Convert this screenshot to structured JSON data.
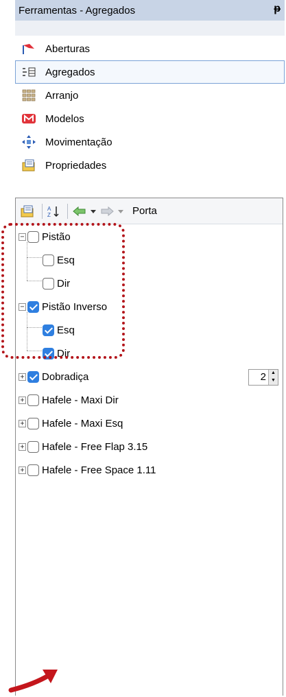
{
  "window": {
    "title": "Ferramentas - Agregados",
    "pin_glyph": "ᵽ"
  },
  "nav": {
    "items": [
      {
        "label": "Aberturas",
        "icon": "flag-icon"
      },
      {
        "label": "Agregados",
        "icon": "aggregates-icon",
        "selected": true
      },
      {
        "label": "Arranjo",
        "icon": "grid-icon"
      },
      {
        "label": "Modelos",
        "icon": "models-icon"
      },
      {
        "label": "Movimentação",
        "icon": "move-icon"
      },
      {
        "label": "Propriedades",
        "icon": "properties-icon"
      }
    ]
  },
  "toolbar": {
    "label": "Porta",
    "icons": [
      "properties-icon",
      "sort-az-icon",
      "back-icon",
      "dropdown-icon",
      "forward-icon",
      "dropdown-icon"
    ]
  },
  "tree": {
    "items": [
      {
        "label": "Pistão",
        "checked": false,
        "expanded": true,
        "level": 0
      },
      {
        "label": "Esq",
        "checked": false,
        "level": 1
      },
      {
        "label": "Dir",
        "checked": false,
        "level": 1
      },
      {
        "label": "Pistão Inverso",
        "checked": true,
        "expanded": true,
        "level": 0
      },
      {
        "label": "Esq",
        "checked": true,
        "level": 1
      },
      {
        "label": "Dir",
        "checked": true,
        "level": 1
      },
      {
        "label": "Dobradiça",
        "checked": true,
        "expanded": false,
        "level": 0,
        "quantity": "2"
      },
      {
        "label": "Hafele - Maxi Dir",
        "checked": false,
        "expanded": false,
        "level": 0
      },
      {
        "label": "Hafele - Maxi Esq",
        "checked": false,
        "expanded": false,
        "level": 0
      },
      {
        "label": "Hafele - Free Flap 3.15",
        "checked": false,
        "expanded": false,
        "level": 0
      },
      {
        "label": "Hafele - Free Space 1.11",
        "checked": false,
        "expanded": false,
        "level": 0
      }
    ]
  },
  "colors": {
    "titlebar": "#c8d4e6",
    "checkbox_on": "#2f7fe0",
    "highlight": "#b3151b",
    "selection_border": "#7aa2d6"
  }
}
